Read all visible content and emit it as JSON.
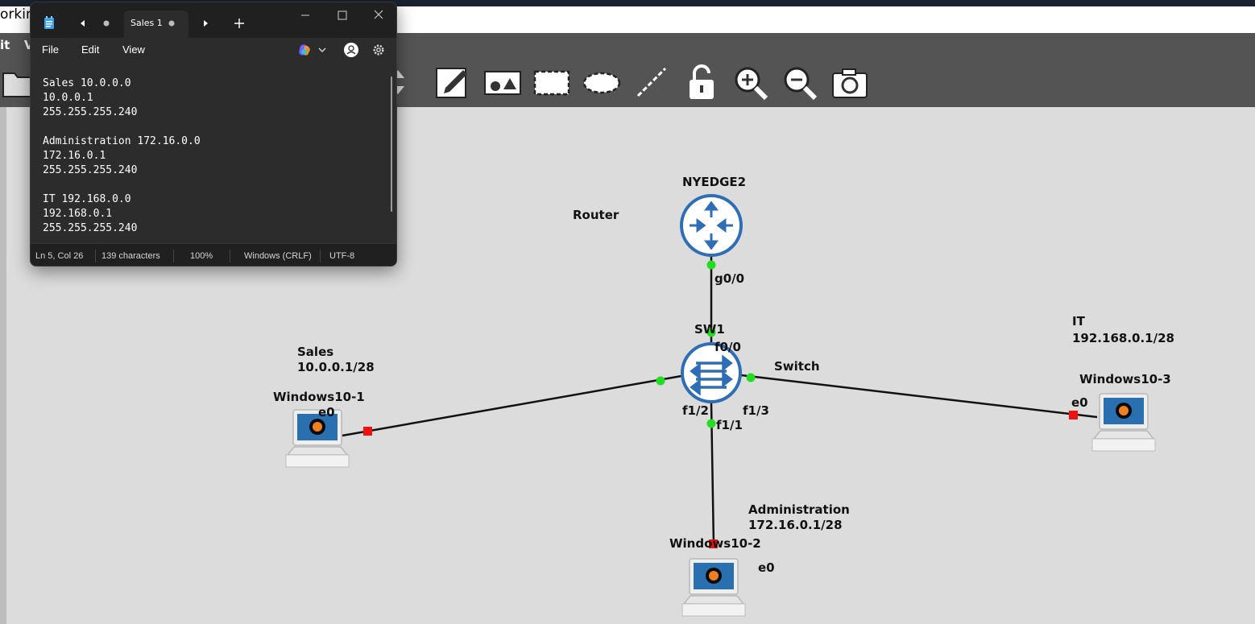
{
  "app": {
    "title_fragment": "orking",
    "menu_fragments": [
      "it",
      "V"
    ]
  },
  "notepad": {
    "tab_title": "Sales 1",
    "menu": [
      "File",
      "Edit",
      "View"
    ],
    "lines": [
      "Sales 10.0.0.0",
      "10.0.0.1",
      "255.255.255.240",
      "",
      "Administration 172.16.0.0",
      "172.16.0.1",
      "255.255.255.240",
      "",
      "IT 192.168.0.0",
      "192.168.0.1",
      "255.255.255.240"
    ],
    "status": {
      "position": "Ln 5, Col 26",
      "characters": "139 characters",
      "zoom": "100%",
      "line_ending": "Windows (CRLF)",
      "encoding": "UTF-8"
    }
  },
  "toolbar": {
    "icons": [
      "folder-icon",
      "annotate-note-icon",
      "insert-picture-icon",
      "draw-rectangle-icon",
      "draw-ellipse-icon",
      "draw-line-icon",
      "lock-icon",
      "zoom-in-icon",
      "zoom-out-icon",
      "screenshot-icon"
    ]
  },
  "topology": {
    "router": {
      "name": "NYEDGE2",
      "type_label": "Router"
    },
    "switch": {
      "name": "SW1",
      "type_label": "Switch"
    },
    "hosts": [
      {
        "name": "Windows10-1",
        "port": "e0",
        "group": "Sales",
        "address": "10.0.0.1/28"
      },
      {
        "name": "Windows10-2",
        "port": "e0",
        "group": "Administration",
        "address": "172.16.0.1/28"
      },
      {
        "name": "Windows10-3",
        "port": "e0",
        "group": "IT",
        "address": "192.168.0.1/28"
      }
    ],
    "ports": {
      "router_g": "g0/0",
      "sw_f00": "f0/0",
      "sw_f12": "f1/2",
      "sw_f11": "f1/1",
      "sw_f13": "f1/3"
    },
    "colors": {
      "link_up": "#22dd22",
      "link_down": "#ee1111",
      "device_blue": "#2f6db5"
    }
  }
}
